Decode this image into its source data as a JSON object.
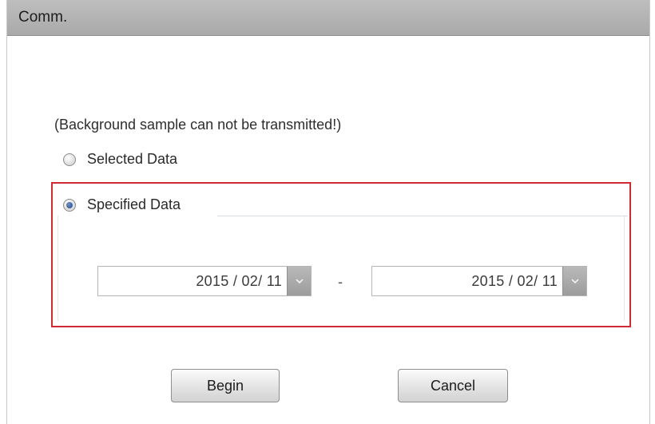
{
  "window": {
    "title": "Comm."
  },
  "notice": "(Background sample can not be transmitted!)",
  "options": {
    "selected_data": {
      "label": "Selected Data",
      "checked": false
    },
    "specified_data": {
      "label": "Specified Data",
      "checked": true
    }
  },
  "date_range": {
    "start": "2015 / 02/ 11",
    "separator": "-",
    "end": "2015 / 02/ 11"
  },
  "buttons": {
    "begin": "Begin",
    "cancel": "Cancel"
  },
  "colors": {
    "highlight_border": "#cf2b36",
    "radio_selected": "#264a87",
    "titlebar": "#b3b3b3"
  },
  "icons": {
    "dropdown": "chevron-down-icon"
  }
}
